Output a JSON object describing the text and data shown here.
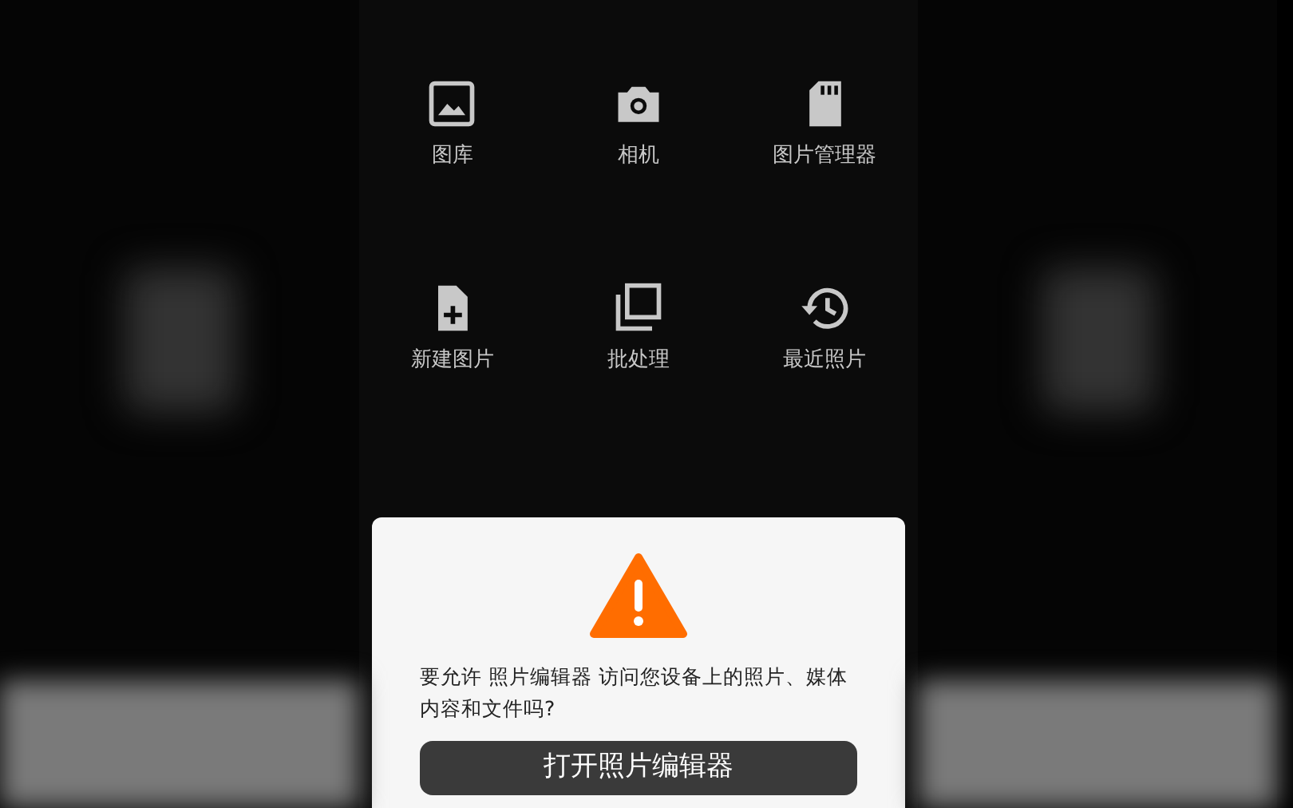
{
  "grid": [
    {
      "kind": "gallery",
      "label": "图库"
    },
    {
      "kind": "camera",
      "label": "相机"
    },
    {
      "kind": "sdcard",
      "label": "图片管理器"
    },
    {
      "kind": "newfile",
      "label": "新建图片"
    },
    {
      "kind": "batch",
      "label": "批处理"
    },
    {
      "kind": "history",
      "label": "最近照片"
    }
  ],
  "dialog": {
    "message": "要允许 照片编辑器 访问您设备上的照片、媒体内容和文件吗?",
    "button": "打开照片编辑器"
  }
}
